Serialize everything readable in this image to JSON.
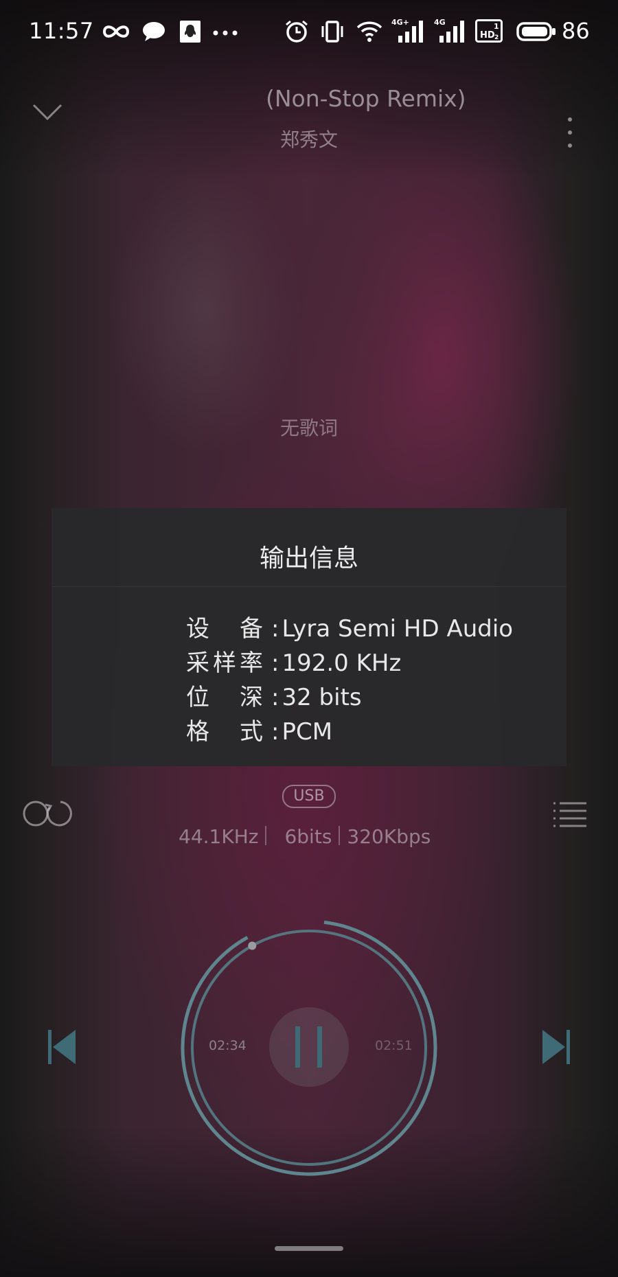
{
  "status_bar": {
    "time": "11:57",
    "battery": "86",
    "left_icons": [
      "infinity-icon",
      "chat-bubble-icon",
      "qq-icon",
      "more-dots-icon"
    ],
    "right_icons": [
      "alarm-icon",
      "vibrate-icon",
      "wifi-icon",
      "signal-4g-plus-icon",
      "signal-4g-icon",
      "hd-icon",
      "battery-icon"
    ]
  },
  "header": {
    "song_title": "(Non-Stop Remix)",
    "artist": "郑秀文"
  },
  "lyrics": {
    "status": "无歌词"
  },
  "output_dialog": {
    "title": "输出信息",
    "rows": [
      {
        "label": "设备",
        "value": "Lyra Semi HD Audio"
      },
      {
        "label": "采样率",
        "value": "192.0 KHz"
      },
      {
        "label": "位深",
        "value": "32 bits"
      },
      {
        "label": "格式",
        "value": "PCM"
      }
    ],
    "separator": ":"
  },
  "audio_quality": {
    "badge": "USB",
    "sample_rate": "44.1KHz",
    "bit_depth": "6bits",
    "bitrate": "320Kbps"
  },
  "playback": {
    "elapsed": "02:34",
    "total": "02:51",
    "progress": 0.9,
    "state": "playing"
  },
  "colors": {
    "accent": "#3e6b75",
    "ring": "#557d86",
    "dialog_bg": "#28282a"
  }
}
